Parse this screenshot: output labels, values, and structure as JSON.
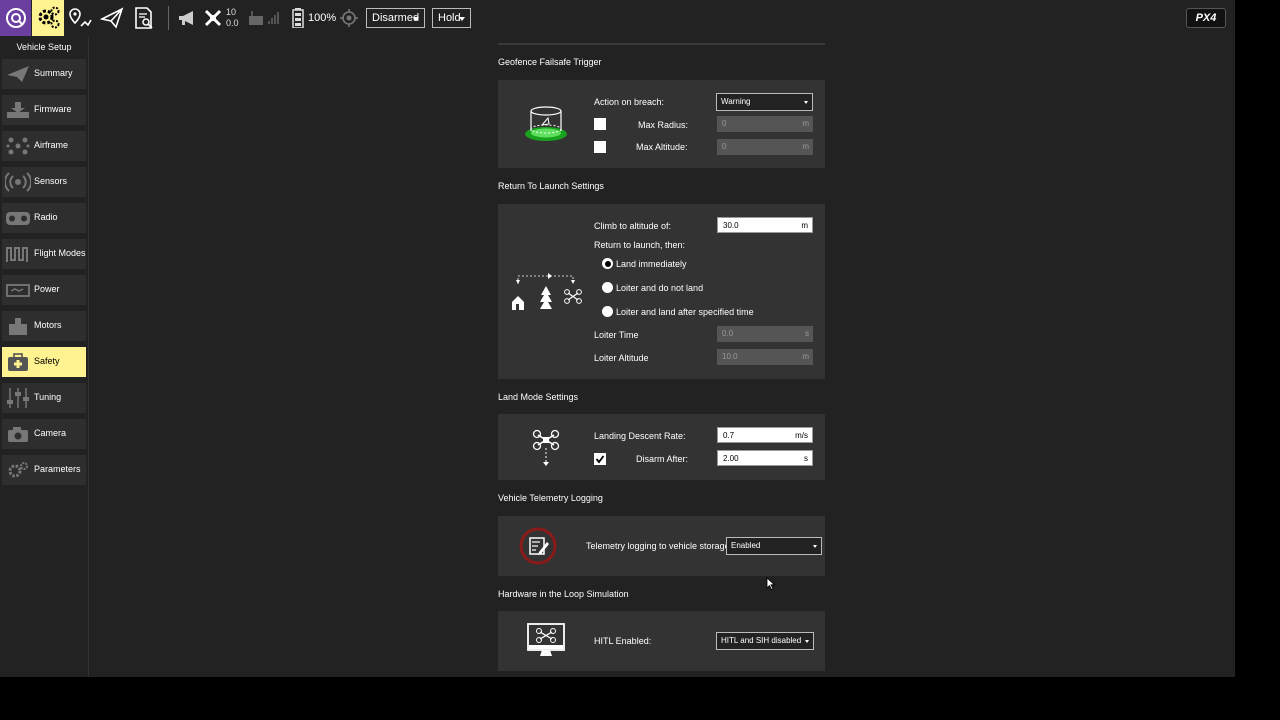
{
  "toolbar": {
    "gps_count": "10",
    "gps_hdop": "0.0",
    "battery": "100%",
    "arm_state": "Disarmed",
    "flight_mode": "Hold",
    "logo": "PX4"
  },
  "sidebar": {
    "title": "Vehicle Setup",
    "items": [
      {
        "label": "Summary",
        "icon": "paper-plane-icon"
      },
      {
        "label": "Firmware",
        "icon": "download-icon"
      },
      {
        "label": "Airframe",
        "icon": "airframe-icon"
      },
      {
        "label": "Sensors",
        "icon": "sensors-icon"
      },
      {
        "label": "Radio",
        "icon": "radio-icon"
      },
      {
        "label": "Flight Modes",
        "icon": "wave-icon"
      },
      {
        "label": "Power",
        "icon": "battery-icon"
      },
      {
        "label": "Motors",
        "icon": "motor-icon"
      },
      {
        "label": "Safety",
        "icon": "first-aid-icon"
      },
      {
        "label": "Tuning",
        "icon": "sliders-icon"
      },
      {
        "label": "Camera",
        "icon": "camera-icon"
      },
      {
        "label": "Parameters",
        "icon": "gears-icon"
      }
    ],
    "active": "Safety",
    "active_color": "#fff291"
  },
  "geofence": {
    "title": "Geofence Failsafe Trigger",
    "action_label": "Action on breach:",
    "action_value": "Warning",
    "max_radius_label": "Max Radius:",
    "max_radius_value": "0",
    "max_radius_unit": "m",
    "max_altitude_label": "Max Altitude:",
    "max_altitude_value": "0",
    "max_altitude_unit": "m"
  },
  "rtl": {
    "title": "Return To Launch Settings",
    "climb_label": "Climb to altitude of:",
    "climb_value": "30.0",
    "climb_unit": "m",
    "then_label": "Return to launch, then:",
    "opt_land": "Land immediately",
    "opt_loiter": "Loiter and do not land",
    "opt_loiter_land": "Loiter and land after specified time",
    "loiter_time_label": "Loiter Time",
    "loiter_time_value": "0.0",
    "loiter_time_unit": "s",
    "loiter_alt_label": "Loiter Altitude",
    "loiter_alt_value": "10.0",
    "loiter_alt_unit": "m"
  },
  "land": {
    "title": "Land Mode Settings",
    "descent_label": "Landing Descent Rate:",
    "descent_value": "0.7",
    "descent_unit": "m/s",
    "disarm_label": "Disarm After:",
    "disarm_value": "2.00",
    "disarm_unit": "s"
  },
  "telemetry": {
    "title": "Vehicle Telemetry Logging",
    "label": "Telemetry logging to vehicle storage:",
    "value": "Enabled"
  },
  "hitl": {
    "title": "Hardware in the Loop Simulation",
    "label": "HITL Enabled:",
    "value": "HITL and SIH disabled"
  }
}
